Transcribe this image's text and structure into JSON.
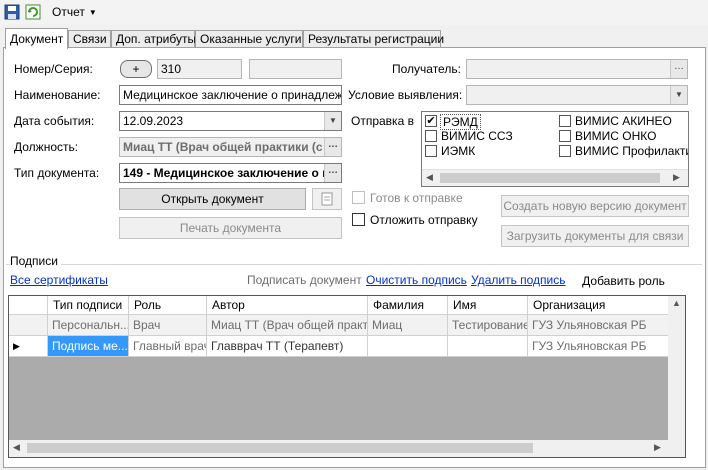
{
  "toolbar": {
    "report_label": "Отчет"
  },
  "tabs": [
    "Документ",
    "Связи",
    "Доп. атрибуты",
    "Оказанные услуги",
    "Результаты регистрации"
  ],
  "form": {
    "number_label": "Номер/Серия:",
    "plus_label": "+",
    "number_value": "310",
    "name_label": "Наименование:",
    "name_value": "Медицинское заключение о принадлежно",
    "event_date_label": "Дата события:",
    "event_date_value": "12.09.2023",
    "position_label": "Должность:",
    "position_value": "Миац ТТ (Врач общей практики (с",
    "doc_type_label": "Тип документа:",
    "doc_type_value": "149 - Медицинское заключение о п",
    "recipient_label": "Получатель:",
    "detection_label": "Условие выявления:",
    "send_to_label": "Отправка в",
    "open_doc_button": "Открыть документ",
    "print_doc_button": "Печать документа",
    "ready_to_send_label": "Готов к отправке",
    "postpone_send_label": "Отложить отправку",
    "create_version_button": "Создать новую версию документ",
    "upload_docs_button": "Загрузить документы для связи"
  },
  "send_targets": [
    {
      "label": "РЭМД",
      "checked": true
    },
    {
      "label": "ВИМИС АКИНЕО",
      "checked": false
    },
    {
      "label": "ВИМИС ССЗ",
      "checked": false
    },
    {
      "label": "ВИМИС ОНКО",
      "checked": false
    },
    {
      "label": "ИЭМК",
      "checked": false
    },
    {
      "label": "ВИМИС Профилактик",
      "checked": false
    }
  ],
  "signatures": {
    "title": "Подписи",
    "all_certs_link": "Все сертификаты",
    "sign_doc": "Подписать документ",
    "clear_sign_link": "Очистить подпись",
    "delete_sign_link": "Удалить подпись",
    "add_role_button": "Добавить роль",
    "columns": [
      "Тип подписи",
      "Роль",
      "Автор",
      "Фамилия",
      "Имя",
      "Организация"
    ],
    "rows": [
      [
        "Персональн...",
        "Врач",
        "Миац ТТ (Врач общей практ...",
        "Миац",
        "Тестирование",
        "ГУЗ Ульяновская РБ"
      ],
      [
        "Подпись ме...",
        "Главный врач",
        "Главврач ТТ (Терапевт)",
        "",
        "",
        "ГУЗ Ульяновская РБ"
      ]
    ]
  },
  "colors": {
    "selection": "#3399ff",
    "link": "#0033cc",
    "grid_bg": "#ababab"
  }
}
